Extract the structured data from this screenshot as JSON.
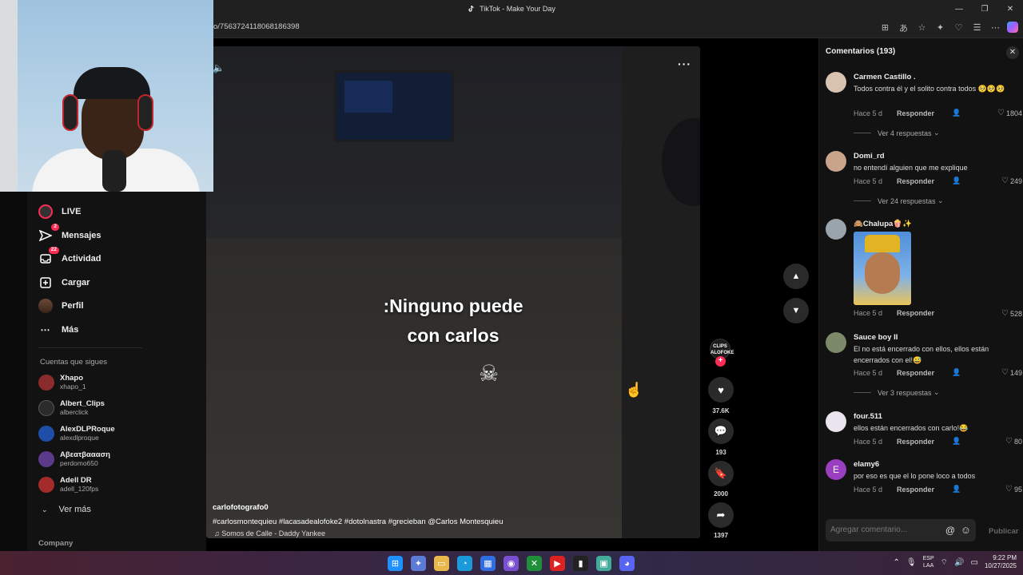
{
  "window": {
    "title": "TikTok - Make Your Day"
  },
  "address": {
    "url": "o/7563724118068186398"
  },
  "sidebar": {
    "items": [
      {
        "label": "LIVE"
      },
      {
        "label": "Mensajes",
        "badge": "2"
      },
      {
        "label": "Actividad",
        "badge": "22"
      },
      {
        "label": "Cargar"
      },
      {
        "label": "Perfil"
      },
      {
        "label": "Más"
      }
    ],
    "following_title": "Cuentas que sigues",
    "following": [
      {
        "name": "Xhapo",
        "handle": "xhapo_1",
        "color": "#8b2c2c"
      },
      {
        "name": "Albert_Clips",
        "handle": "alberclick",
        "color": "#2b2b2b"
      },
      {
        "name": "AlexDLPRoque",
        "handle": "alexdlproque",
        "color": "#1f4ea8"
      },
      {
        "name": "Aβεατβαααση",
        "handle": "perdomo650",
        "color": "#5c3a8a"
      },
      {
        "name": "Adell DR",
        "handle": "adell_120fps",
        "color": "#a32b2b"
      }
    ],
    "see_more": "Ver más",
    "company": "Company"
  },
  "video": {
    "caption_line1": ":Ninguno puede",
    "caption_line2": "con carlos",
    "skull": "☠",
    "username": "carlofotografo0",
    "tags": "#carlosmontequieu  #lacasadealofoke2  #dotolnastra  #grecieban  @Carlos Montesquieu",
    "music": "♫ Somos de Calle - Daddy Yankee",
    "creator_badge": "CLIPS ALOFOKE",
    "likes": "37.6K",
    "comments": "193",
    "saves": "2000",
    "shares": "1397"
  },
  "comments_panel": {
    "title": "Comentarios (193)",
    "placeholder": "Agregar comentario...",
    "publish": "Publicar",
    "reply_label": "Responder",
    "items": [
      {
        "name": "Carmen Castillo .",
        "text": "Todos contra él y el solito contra todos 🥺🥺🥺",
        "time": "Hace 5 d",
        "likes": "1804",
        "replies": "Ver 4 respuestas",
        "color": "#d7c3b0"
      },
      {
        "name": "Domi_rd",
        "text": "no entendí alguien que me explique",
        "time": "Hace 5 d",
        "likes": "249",
        "replies": "Ver 24 respuestas",
        "color": "#c9a38a"
      },
      {
        "name": "🙈Chalupa🍿✨",
        "text": "",
        "time": "Hace 5 d",
        "likes": "528",
        "replies": "",
        "color": "#9aa4ad"
      },
      {
        "name": "Sauce boy II",
        "text": "El no está encerrado con ellos, ellos están encerrados con el!😅",
        "time": "Hace 5 d",
        "likes": "149",
        "replies": "Ver 3 respuestas",
        "color": "#7d8a6a"
      },
      {
        "name": "four.511",
        "text": "ellos están encerrados con carlo!😂",
        "time": "Hace 5 d",
        "likes": "80",
        "replies": "",
        "color": "#e9e4ee"
      },
      {
        "name": "elamy6",
        "text": "por eso es que el lo pone loco a todos",
        "time": "Hace 5 d",
        "likes": "95",
        "replies": "",
        "color": "#9a3fc0",
        "initial": "E"
      }
    ]
  },
  "taskbar": {
    "lang": "ESP",
    "lang2": "LAA",
    "time": "9:22 PM",
    "date": "10/27/2025"
  }
}
